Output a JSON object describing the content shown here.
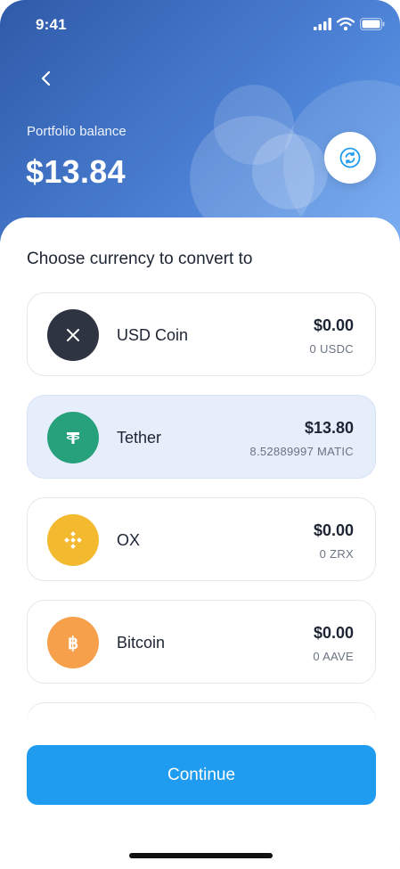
{
  "status_bar": {
    "time": "9:41"
  },
  "header": {
    "balance_label": "Portfolio balance",
    "balance_value": "$13.84",
    "gradient_start": "#2f5aa8",
    "gradient_end": "#6aa6f2"
  },
  "section_title": "Choose currency to convert to",
  "currencies": [
    {
      "name": "USD Coin",
      "usd": "$0.00",
      "amount": "0 USDC",
      "icon": "usd-coin-icon",
      "color": "#2e3441",
      "selected": false
    },
    {
      "name": "Tether",
      "usd": "$13.80",
      "amount": "8.52889997 MATIC",
      "icon": "tether-icon",
      "color": "#26a17b",
      "selected": true
    },
    {
      "name": "OX",
      "usd": "$0.00",
      "amount": "0 ZRX",
      "icon": "binance-icon",
      "color": "#f3ba2f",
      "selected": false
    },
    {
      "name": "Bitcoin",
      "usd": "$0.00",
      "amount": "0 AAVE",
      "icon": "bitcoin-icon",
      "color": "#f7a04b",
      "selected": false
    }
  ],
  "continue_label": "Continue",
  "accent_color": "#1f9cef",
  "selected_row_color": "#e6eefb"
}
